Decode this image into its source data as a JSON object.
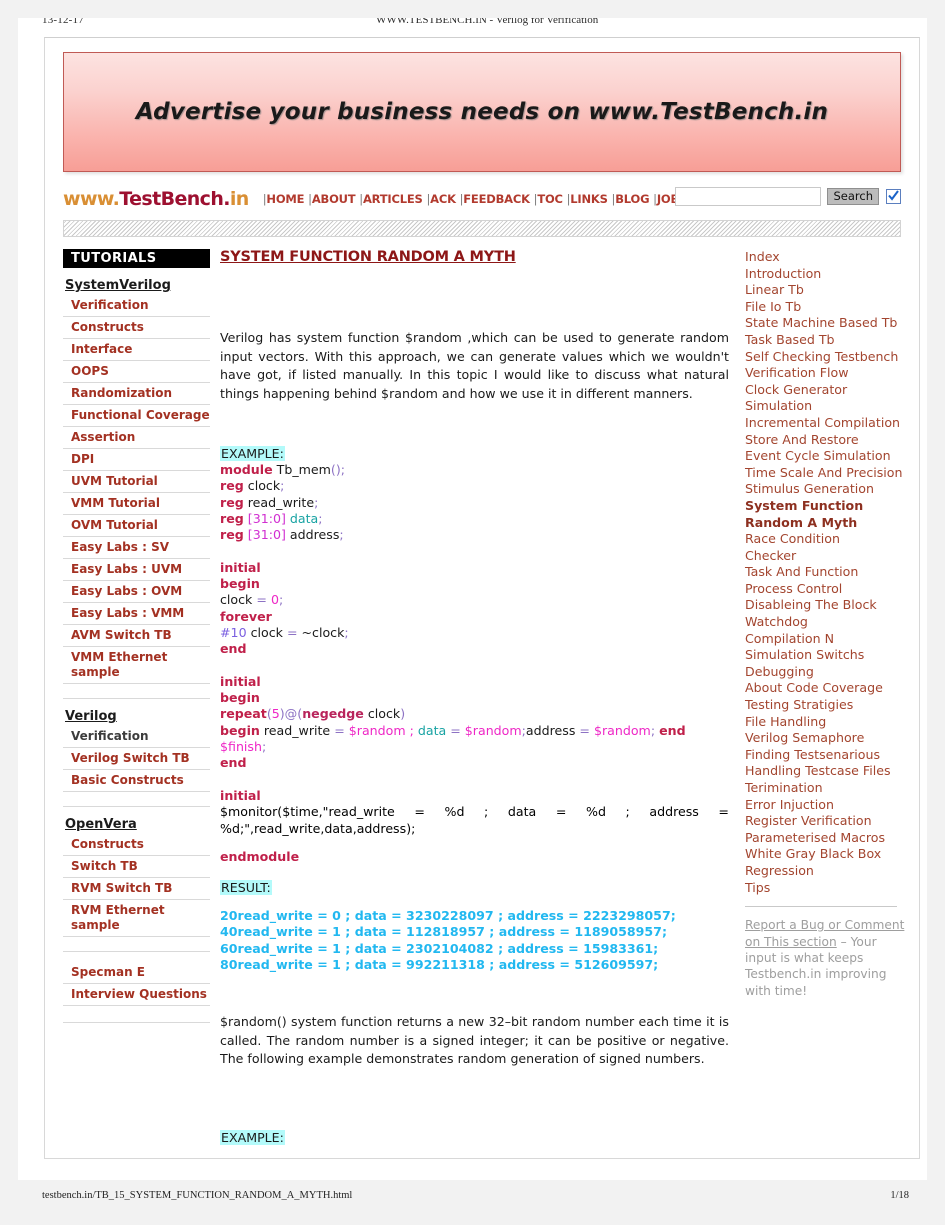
{
  "runninghead": {
    "date": "13-12-17",
    "title": "WWW.TESTBENCH.IN - Verilog for Verification"
  },
  "banner": {
    "text": "Advertise your business needs on www.TestBench.in"
  },
  "brand": {
    "part1": "www.",
    "part2": "TestBench.",
    "part3": "in"
  },
  "nav": {
    "items": [
      "HOME",
      "ABOUT",
      "ARTICLES",
      "ACK",
      "FEEDBACK",
      "TOC",
      "LINKS",
      "BLOG",
      "JOBS"
    ],
    "separator": "|"
  },
  "search": {
    "value": "",
    "placeholder": "",
    "button_label": "Search",
    "checkbox_checked": true
  },
  "sidebar": {
    "header": "TUTORIALS",
    "groups": [
      {
        "title": "SystemVerilog",
        "items": [
          {
            "label": "Verification",
            "visited": false
          },
          {
            "label": "Constructs",
            "visited": false
          },
          {
            "label": "Interface",
            "visited": false
          },
          {
            "label": "OOPS",
            "visited": false
          },
          {
            "label": "Randomization",
            "visited": false
          },
          {
            "label": "Functional Coverage",
            "visited": false
          },
          {
            "label": "Assertion",
            "visited": false
          },
          {
            "label": "DPI",
            "visited": false
          },
          {
            "label": "UVM Tutorial",
            "visited": false
          },
          {
            "label": "VMM Tutorial",
            "visited": false
          },
          {
            "label": "OVM Tutorial",
            "visited": false
          },
          {
            "label": "Easy Labs : SV",
            "visited": false
          },
          {
            "label": "Easy Labs : UVM",
            "visited": false
          },
          {
            "label": "Easy Labs : OVM",
            "visited": false
          },
          {
            "label": "Easy Labs : VMM",
            "visited": false
          },
          {
            "label": "AVM Switch TB",
            "visited": false
          },
          {
            "label": "VMM Ethernet sample",
            "visited": false
          }
        ]
      },
      {
        "title": "Verilog",
        "items": [
          {
            "label": "Verification",
            "visited": true
          },
          {
            "label": "Verilog Switch TB",
            "visited": false
          },
          {
            "label": "Basic Constructs",
            "visited": false
          }
        ]
      },
      {
        "title": "OpenVera",
        "items": [
          {
            "label": "Constructs",
            "visited": false
          },
          {
            "label": "Switch TB",
            "visited": false
          },
          {
            "label": "RVM Switch TB",
            "visited": false
          },
          {
            "label": "RVM Ethernet sample",
            "visited": false
          }
        ]
      },
      {
        "title": "",
        "items": [
          {
            "label": "Specman E",
            "visited": false
          },
          {
            "label": "Interview Questions",
            "visited": false
          }
        ]
      }
    ]
  },
  "article": {
    "title": "SYSTEM FUNCTION RANDOM A MYTH",
    "intro": "Verilog has system function $random ,which can be used to generate random input vectors. With this approach, we can generate values which we wouldn't have got, if listed manually. In this topic I would like to discuss what natural things happening behind $random and how we use it in different manners.",
    "example_label": "EXAMPLE:",
    "result_label": "RESULT:",
    "example_label_2": "EXAMPLE:",
    "code": {
      "l01_kw": "module",
      "l01_name": " Tb_mem",
      "l01_paren": "()",
      "l01_semi": ";",
      "l02_kw": "reg",
      "l02_name": " clock",
      "l02_semi": ";",
      "l03_kw": "reg",
      "l03_name": " read_write",
      "l03_semi": ";",
      "l04_kw": "reg",
      "l04_rng": " [31:0] ",
      "l04_name": "data",
      "l04_semi": ";",
      "l05_kw": "reg",
      "l05_rng": " [31:0] ",
      "l05_name": "address",
      "l05_semi": ";",
      "l06_kw": "initial",
      "l07_kw": "begin",
      "l08_a": "clock ",
      "l08_eq": "=",
      "l08_b": " ",
      "l08_num": "0",
      "l08_semi": ";",
      "l09_kw": "forever",
      "l10_hash": "#10",
      "l10_a": " clock ",
      "l10_eq": "=",
      "l10_b": " ~clock",
      "l10_semi": ";",
      "l11_kw": "end",
      "l12_kw": "initial",
      "l13_kw": "begin",
      "l14_kw": "repeat",
      "l14_p1": "(",
      "l14_num": "5",
      "l14_p2": ")@(",
      "l14_kw2": "negedge",
      "l14_rest": " clock",
      "l14_p3": ")",
      "l15_kw": "begin",
      "l15_a": " read_write ",
      "l15_eq1": "=",
      "l15_r1": " $random ; ",
      "l15_data": "data",
      "l15_eq2": " = ",
      "l15_r2": "$random",
      "l15_semi1": ";",
      "l15_addr": "address ",
      "l15_eq3": "=",
      "l15_r3": " $random",
      "l15_semi2": "; ",
      "l15_end": "end",
      "l16_finish": "$finish",
      "l16_semi": ";",
      "l17_kw": "end",
      "l18_kw": "initial",
      "l19_mon": "$monitor($time,",
      "l19_str": "\"read_write    =    %d    ;    data    =    %d    ;    address    =    %d;\"",
      "l19_a": ",read_write,",
      "l19_data": "data",
      "l19_b": ",address",
      "l19_p": ")",
      "l19_semi": ";",
      "l20_kw": "endmodule"
    },
    "results": [
      "20read_write = 0 ; data = 3230228097 ; address = 2223298057;",
      "40read_write = 1 ; data = 112818957 ; address = 1189058957;",
      "60read_write = 1 ; data = 2302104082 ; address = 15983361;",
      "80read_write = 1 ; data = 992211318 ; address = 512609597;"
    ],
    "outro": "$random() system function returns a new 32–bit random number each time it is called. The random number is a signed integer; it can be positive or negative. The following example demonstrates random generation of signed numbers."
  },
  "toc": {
    "items": [
      {
        "label": "Index",
        "current": false
      },
      {
        "label": "Introduction",
        "current": false
      },
      {
        "label": "Linear Tb",
        "current": false
      },
      {
        "label": "File Io Tb",
        "current": false
      },
      {
        "label": "State Machine Based Tb",
        "current": false
      },
      {
        "label": "Task Based Tb",
        "current": false
      },
      {
        "label": "Self Checking Testbench",
        "current": false
      },
      {
        "label": "Verification Flow",
        "current": false
      },
      {
        "label": "Clock Generator",
        "current": false
      },
      {
        "label": "Simulation",
        "current": false
      },
      {
        "label": "Incremental Compilation",
        "current": false
      },
      {
        "label": "Store And Restore",
        "current": false
      },
      {
        "label": "Event Cycle Simulation",
        "current": false
      },
      {
        "label": "Time Scale And Precision",
        "current": false
      },
      {
        "label": "Stimulus Generation",
        "current": false
      },
      {
        "label": "System Function Random A Myth",
        "current": true
      },
      {
        "label": "Race Condition",
        "current": false
      },
      {
        "label": "Checker",
        "current": false
      },
      {
        "label": "Task And Function",
        "current": false
      },
      {
        "label": "Process Control",
        "current": false
      },
      {
        "label": "Disableing The Block",
        "current": false
      },
      {
        "label": "Watchdog",
        "current": false
      },
      {
        "label": "Compilation N",
        "current": false
      },
      {
        "label": "Simulation Switchs",
        "current": false
      },
      {
        "label": "Debugging",
        "current": false
      },
      {
        "label": "About Code Coverage",
        "current": false
      },
      {
        "label": "Testing Stratigies",
        "current": false
      },
      {
        "label": "File Handling",
        "current": false
      },
      {
        "label": "Verilog Semaphore",
        "current": false
      },
      {
        "label": "Finding Testsenarious",
        "current": false
      },
      {
        "label": "Handling Testcase Files",
        "current": false
      },
      {
        "label": "Terimination",
        "current": false
      },
      {
        "label": "Error Injuction",
        "current": false
      },
      {
        "label": "Register Verification",
        "current": false
      },
      {
        "label": "Parameterised Macros",
        "current": false
      },
      {
        "label": "White Gray Black Box",
        "current": false
      },
      {
        "label": "Regression",
        "current": false
      },
      {
        "label": "Tips",
        "current": false
      }
    ],
    "bug_link": "Report a Bug or Comment on This section",
    "bug_text": " – Your input is what keeps Testbench.in improving with time!"
  },
  "footer": {
    "url": "testbench.in/TB_15_SYSTEM_FUNCTION_RANDOM_A_MYTH.html",
    "page": "1/18"
  },
  "colors": {
    "brand_red": "#9d1030",
    "brand_orange": "#d98f34",
    "nav_red": "#b23a2e",
    "sidebar_link": "#a33122",
    "toc_link": "#a3452f",
    "title_red": "#8d1717",
    "highlight_cyan": "#b3fafa",
    "result_blue": "#22b8f0"
  }
}
